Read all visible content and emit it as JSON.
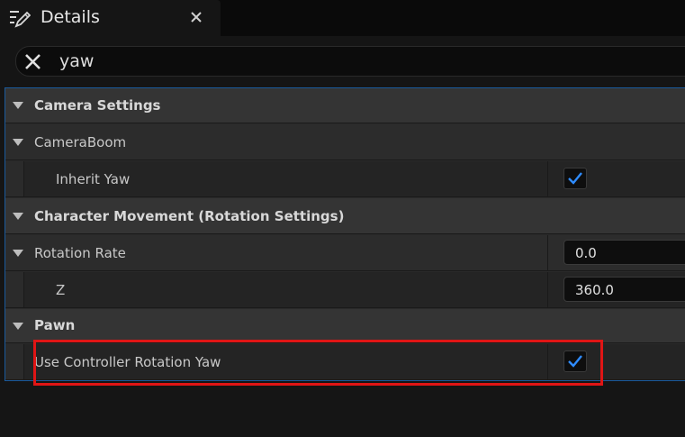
{
  "tab": {
    "title": "Details",
    "icon": "edit-details-icon",
    "close_icon": "close-icon"
  },
  "search": {
    "value": "yaw",
    "clear_icon": "clear-icon"
  },
  "rows": {
    "camera_settings": {
      "label": "Camera Settings"
    },
    "camera_boom": {
      "label": "CameraBoom"
    },
    "inherit_yaw": {
      "label": "Inherit Yaw",
      "checked": true
    },
    "character_movement": {
      "label": "Character Movement (Rotation Settings)"
    },
    "rotation_rate": {
      "label": "Rotation Rate",
      "value": "0.0"
    },
    "z": {
      "label": "Z",
      "value": "360.0"
    },
    "pawn": {
      "label": "Pawn"
    },
    "use_controller_rotation_yaw": {
      "label": "Use Controller Rotation Yaw",
      "checked": true
    }
  },
  "colors": {
    "accent": "#1a5a9c",
    "checkmark": "#2f8cff",
    "highlight": "#e01515"
  }
}
